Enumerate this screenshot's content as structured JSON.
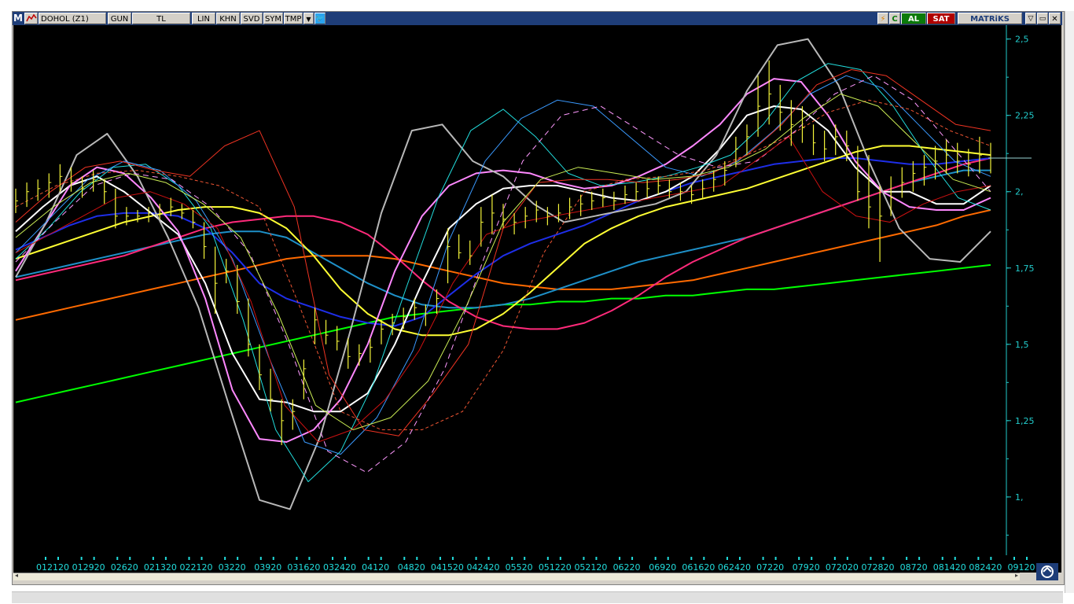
{
  "toolbar": {
    "logo": "M",
    "symbol": "DOHOL (Z1)",
    "period": "GUN",
    "currency": "TL",
    "buttons": [
      "LIN",
      "KHN",
      "SVD",
      "SYM",
      "TMP"
    ],
    "buy_label": "AL",
    "sell_label": "SAT",
    "brand": "MATRiKS",
    "colors": {
      "bar": "#1e3d78",
      "buy": "#0a7a0a",
      "sell": "#b00000",
      "brand": "#1e3d78"
    },
    "icons": [
      "app-logo-icon",
      "chart-type-icon",
      "dropdown-arrow-icon",
      "twitter-icon",
      "lightning-icon",
      "refresh-icon",
      "minimize-icon",
      "restore-icon",
      "close-icon"
    ]
  },
  "chart_data": {
    "type": "line",
    "symbol": "DOHOL (Z1)",
    "y_ticks": [
      "2,5",
      "2,25",
      "2,",
      "1,75",
      "1,5",
      "1,25",
      "1,"
    ],
    "y_tick_values": [
      2.5,
      2.25,
      2.0,
      1.75,
      1.5,
      1.25,
      1.0
    ],
    "ylim": [
      0.84,
      2.53
    ],
    "x_ticks": [
      "012120",
      "012920",
      "02620",
      "021320",
      "022120",
      "03220",
      "03920",
      "031620",
      "032420",
      "04120",
      "04820",
      "041520",
      "042420",
      "05520",
      "051220",
      "052120",
      "06220",
      "06920",
      "061620",
      "062420",
      "07220",
      "07920",
      "072020",
      "072820",
      "08720",
      "081420",
      "082420",
      "09120"
    ],
    "grid": false,
    "last_price": 2.11,
    "price_bars": [
      {
        "h": 2.01,
        "l": 1.93,
        "c": 1.97
      },
      {
        "h": 2.03,
        "l": 1.95,
        "c": 2.0
      },
      {
        "h": 2.04,
        "l": 1.97,
        "c": 2.01
      },
      {
        "h": 2.06,
        "l": 1.98,
        "c": 2.03
      },
      {
        "h": 2.09,
        "l": 2.0,
        "c": 2.05
      },
      {
        "h": 2.08,
        "l": 2.0,
        "c": 2.03
      },
      {
        "h": 2.05,
        "l": 1.98,
        "c": 2.01
      },
      {
        "h": 2.07,
        "l": 2.0,
        "c": 2.04
      },
      {
        "h": 2.04,
        "l": 1.96,
        "c": 2.0
      },
      {
        "h": 2.01,
        "l": 1.88,
        "c": 1.92
      },
      {
        "h": 1.95,
        "l": 1.89,
        "c": 1.92
      },
      {
        "h": 1.94,
        "l": 1.9,
        "c": 1.92
      },
      {
        "h": 1.95,
        "l": 1.9,
        "c": 1.93
      },
      {
        "h": 1.96,
        "l": 1.91,
        "c": 1.94
      },
      {
        "h": 1.98,
        "l": 1.92,
        "c": 1.95
      },
      {
        "h": 1.96,
        "l": 1.91,
        "c": 1.93
      },
      {
        "h": 1.94,
        "l": 1.88,
        "c": 1.9
      },
      {
        "h": 1.9,
        "l": 1.78,
        "c": 1.82
      },
      {
        "h": 1.82,
        "l": 1.6,
        "c": 1.7
      },
      {
        "h": 1.78,
        "l": 1.7,
        "c": 1.74
      },
      {
        "h": 1.76,
        "l": 1.6,
        "c": 1.64
      },
      {
        "h": 1.65,
        "l": 1.46,
        "c": 1.5
      },
      {
        "h": 1.5,
        "l": 1.35,
        "c": 1.4
      },
      {
        "h": 1.42,
        "l": 1.28,
        "c": 1.32
      },
      {
        "h": 1.32,
        "l": 1.17,
        "c": 1.25
      },
      {
        "h": 1.32,
        "l": 1.22,
        "c": 1.28
      },
      {
        "h": 1.45,
        "l": 1.32,
        "c": 1.42
      },
      {
        "h": 1.62,
        "l": 1.5,
        "c": 1.58
      },
      {
        "h": 1.58,
        "l": 1.5,
        "c": 1.53
      },
      {
        "h": 1.56,
        "l": 1.48,
        "c": 1.51
      },
      {
        "h": 1.52,
        "l": 1.42,
        "c": 1.46
      },
      {
        "h": 1.5,
        "l": 1.43,
        "c": 1.47
      },
      {
        "h": 1.52,
        "l": 1.44,
        "c": 1.49
      },
      {
        "h": 1.58,
        "l": 1.5,
        "c": 1.55
      },
      {
        "h": 1.6,
        "l": 1.53,
        "c": 1.57
      },
      {
        "h": 1.62,
        "l": 1.55,
        "c": 1.59
      },
      {
        "h": 1.65,
        "l": 1.58,
        "c": 1.62
      },
      {
        "h": 1.63,
        "l": 1.56,
        "c": 1.6
      },
      {
        "h": 1.68,
        "l": 1.6,
        "c": 1.65
      },
      {
        "h": 1.88,
        "l": 1.7,
        "c": 1.82
      },
      {
        "h": 1.86,
        "l": 1.78,
        "c": 1.8
      },
      {
        "h": 1.84,
        "l": 1.76,
        "c": 1.79
      },
      {
        "h": 1.95,
        "l": 1.82,
        "c": 1.9
      },
      {
        "h": 1.99,
        "l": 1.86,
        "c": 1.93
      },
      {
        "h": 1.96,
        "l": 1.88,
        "c": 1.91
      },
      {
        "h": 1.93,
        "l": 1.86,
        "c": 1.9
      },
      {
        "h": 1.95,
        "l": 1.88,
        "c": 1.92
      },
      {
        "h": 1.97,
        "l": 1.9,
        "c": 1.94
      },
      {
        "h": 1.95,
        "l": 1.89,
        "c": 1.92
      },
      {
        "h": 1.96,
        "l": 1.9,
        "c": 1.93
      },
      {
        "h": 1.98,
        "l": 1.91,
        "c": 1.95
      },
      {
        "h": 1.99,
        "l": 1.92,
        "c": 1.96
      },
      {
        "h": 2.0,
        "l": 1.94,
        "c": 1.97
      },
      {
        "h": 2.01,
        "l": 1.95,
        "c": 1.98
      },
      {
        "h": 2.0,
        "l": 1.94,
        "c": 1.97
      },
      {
        "h": 2.02,
        "l": 1.96,
        "c": 1.99
      },
      {
        "h": 2.03,
        "l": 1.97,
        "c": 2.0
      },
      {
        "h": 2.04,
        "l": 1.98,
        "c": 2.01
      },
      {
        "h": 2.05,
        "l": 1.99,
        "c": 2.02
      },
      {
        "h": 2.04,
        "l": 1.98,
        "c": 2.0
      },
      {
        "h": 2.03,
        "l": 1.97,
        "c": 2.0
      },
      {
        "h": 2.02,
        "l": 1.96,
        "c": 1.99
      },
      {
        "h": 2.04,
        "l": 1.98,
        "c": 2.01
      },
      {
        "h": 2.07,
        "l": 2.0,
        "c": 2.04
      },
      {
        "h": 2.1,
        "l": 2.02,
        "c": 2.07
      },
      {
        "h": 2.18,
        "l": 2.08,
        "c": 2.14
      },
      {
        "h": 2.22,
        "l": 2.12,
        "c": 2.18
      },
      {
        "h": 2.38,
        "l": 2.18,
        "c": 2.28
      },
      {
        "h": 2.43,
        "l": 2.22,
        "c": 2.32
      },
      {
        "h": 2.35,
        "l": 2.2,
        "c": 2.26
      },
      {
        "h": 2.3,
        "l": 2.15,
        "c": 2.22
      },
      {
        "h": 2.28,
        "l": 2.16,
        "c": 2.21
      },
      {
        "h": 2.22,
        "l": 2.12,
        "c": 2.16
      },
      {
        "h": 2.2,
        "l": 2.1,
        "c": 2.14
      },
      {
        "h": 2.22,
        "l": 2.12,
        "c": 2.18
      },
      {
        "h": 2.2,
        "l": 2.1,
        "c": 2.15
      },
      {
        "h": 2.15,
        "l": 1.97,
        "c": 2.0
      },
      {
        "h": 2.12,
        "l": 1.88,
        "c": 1.95
      },
      {
        "h": 2.02,
        "l": 1.77,
        "c": 1.92
      },
      {
        "h": 2.05,
        "l": 1.92,
        "c": 1.98
      },
      {
        "h": 2.08,
        "l": 1.98,
        "c": 2.03
      },
      {
        "h": 2.1,
        "l": 2.0,
        "c": 2.06
      },
      {
        "h": 2.12,
        "l": 2.02,
        "c": 2.08
      },
      {
        "h": 2.15,
        "l": 2.04,
        "c": 2.1
      },
      {
        "h": 2.17,
        "l": 2.06,
        "c": 2.12
      },
      {
        "h": 2.16,
        "l": 2.06,
        "c": 2.1
      },
      {
        "h": 2.14,
        "l": 2.05,
        "c": 2.09
      },
      {
        "h": 2.18,
        "l": 2.06,
        "c": 2.12
      },
      {
        "h": 2.16,
        "l": 2.06,
        "c": 2.11
      }
    ],
    "series": [
      {
        "color": "#00ff00",
        "width": 2,
        "dash": "",
        "values": [
          1.31,
          1.33,
          1.35,
          1.37,
          1.39,
          1.41,
          1.43,
          1.45,
          1.47,
          1.49,
          1.51,
          1.53,
          1.55,
          1.57,
          1.59,
          1.6,
          1.61,
          1.62,
          1.63,
          1.63,
          1.64,
          1.64,
          1.65,
          1.65,
          1.66,
          1.66,
          1.67,
          1.68,
          1.68,
          1.69,
          1.7,
          1.71,
          1.72,
          1.73,
          1.74,
          1.75,
          1.76
        ]
      },
      {
        "color": "#ff6a00",
        "width": 2,
        "dash": "",
        "values": [
          1.58,
          1.6,
          1.62,
          1.64,
          1.66,
          1.68,
          1.7,
          1.72,
          1.74,
          1.76,
          1.78,
          1.79,
          1.79,
          1.79,
          1.78,
          1.76,
          1.74,
          1.72,
          1.7,
          1.69,
          1.68,
          1.68,
          1.68,
          1.69,
          1.7,
          1.71,
          1.73,
          1.75,
          1.77,
          1.79,
          1.81,
          1.83,
          1.85,
          1.87,
          1.89,
          1.92,
          1.94
        ]
      },
      {
        "color": "#1e90c8",
        "width": 2,
        "dash": "",
        "values": [
          1.72,
          1.74,
          1.76,
          1.78,
          1.8,
          1.82,
          1.84,
          1.86,
          1.87,
          1.87,
          1.85,
          1.8,
          1.75,
          1.7,
          1.66,
          1.63,
          1.62,
          1.62,
          1.63,
          1.65,
          1.68,
          1.71,
          1.74,
          1.77,
          1.79,
          1.81,
          1.83,
          1.85,
          1.88,
          1.91,
          1.94,
          1.97,
          2.0,
          2.03,
          2.05,
          2.07,
          2.07
        ]
      },
      {
        "color": "#ff2a7a",
        "width": 2,
        "dash": "",
        "values": [
          1.71,
          1.73,
          1.75,
          1.77,
          1.79,
          1.82,
          1.85,
          1.88,
          1.9,
          1.91,
          1.92,
          1.92,
          1.9,
          1.86,
          1.79,
          1.71,
          1.64,
          1.59,
          1.56,
          1.55,
          1.55,
          1.57,
          1.61,
          1.66,
          1.72,
          1.77,
          1.81,
          1.85,
          1.88,
          1.91,
          1.94,
          1.97,
          2.0,
          2.03,
          2.06,
          2.09,
          2.11
        ]
      },
      {
        "color": "#1e2ee8",
        "width": 2,
        "dash": "",
        "values": [
          1.81,
          1.85,
          1.89,
          1.92,
          1.93,
          1.93,
          1.92,
          1.88,
          1.8,
          1.7,
          1.65,
          1.62,
          1.59,
          1.57,
          1.56,
          1.59,
          1.66,
          1.73,
          1.79,
          1.83,
          1.86,
          1.89,
          1.93,
          1.97,
          2.0,
          2.03,
          2.05,
          2.07,
          2.09,
          2.1,
          2.11,
          2.11,
          2.1,
          2.09,
          2.09,
          2.1,
          2.11
        ]
      },
      {
        "color": "#ffff33",
        "width": 2,
        "dash": "",
        "values": [
          1.78,
          1.81,
          1.84,
          1.87,
          1.9,
          1.92,
          1.94,
          1.95,
          1.95,
          1.93,
          1.88,
          1.79,
          1.68,
          1.6,
          1.55,
          1.53,
          1.53,
          1.55,
          1.6,
          1.67,
          1.75,
          1.83,
          1.88,
          1.92,
          1.95,
          1.97,
          1.99,
          2.01,
          2.04,
          2.07,
          2.1,
          2.13,
          2.15,
          2.15,
          2.14,
          2.13,
          2.12
        ]
      },
      {
        "color": "#ffffff",
        "width": 2,
        "dash": "",
        "values": [
          1.87,
          1.95,
          2.02,
          2.05,
          2.0,
          1.93,
          1.86,
          1.7,
          1.47,
          1.32,
          1.31,
          1.28,
          1.28,
          1.34,
          1.5,
          1.7,
          1.88,
          1.96,
          2.01,
          2.02,
          2.02,
          2.0,
          1.98,
          1.97,
          2.0,
          2.05,
          2.14,
          2.25,
          2.28,
          2.27,
          2.2,
          2.08,
          2.0,
          2.0,
          1.96,
          1.96,
          2.02
        ]
      },
      {
        "color": "#ff88ff",
        "width": 2,
        "dash": "",
        "values": [
          1.74,
          1.88,
          2.02,
          2.08,
          2.06,
          1.98,
          1.87,
          1.65,
          1.35,
          1.19,
          1.18,
          1.22,
          1.32,
          1.5,
          1.74,
          1.92,
          2.02,
          2.06,
          2.07,
          2.06,
          2.03,
          2.01,
          2.02,
          2.05,
          2.09,
          2.15,
          2.22,
          2.32,
          2.37,
          2.36,
          2.25,
          2.1,
          2.0,
          1.95,
          1.94,
          1.94,
          1.98
        ]
      },
      {
        "color": "#b8b8b8",
        "width": 2,
        "dash": "",
        "values": [
          1.72,
          1.9,
          2.12,
          2.19,
          2.05,
          1.85,
          1.62,
          1.3,
          0.99,
          0.96,
          1.2,
          1.55,
          1.93,
          2.2,
          2.22,
          2.1,
          2.05,
          1.96,
          1.9,
          1.92,
          1.94,
          1.96,
          2.0,
          2.12,
          2.33,
          2.48,
          2.5,
          2.35,
          2.1,
          1.88,
          1.78,
          1.77,
          1.87
        ]
      },
      {
        "color": "#22dddd",
        "width": 1,
        "dash": "",
        "values": [
          1.78,
          1.88,
          2.0,
          2.08,
          2.09,
          2.02,
          1.88,
          1.58,
          1.22,
          1.05,
          1.15,
          1.37,
          1.68,
          1.98,
          2.2,
          2.27,
          2.18,
          2.06,
          2.02,
          2.03,
          2.05,
          2.08,
          2.12,
          2.22,
          2.36,
          2.42,
          2.4,
          2.28,
          2.12,
          1.98,
          1.94
        ]
      },
      {
        "color": "#3a9aff",
        "width": 1,
        "dash": "",
        "values": [
          1.8,
          1.92,
          2.04,
          2.1,
          2.07,
          1.97,
          1.78,
          1.46,
          1.18,
          1.14,
          1.26,
          1.48,
          1.84,
          2.1,
          2.24,
          2.3,
          2.28,
          2.18,
          2.08,
          2.05,
          2.1,
          2.2,
          2.32,
          2.38,
          2.34,
          2.22,
          2.1,
          2.05
        ]
      },
      {
        "color": "#ee3322",
        "width": 1,
        "dash": "",
        "values": [
          1.9,
          2.0,
          2.08,
          2.1,
          2.07,
          2.05,
          2.15,
          2.2,
          1.95,
          1.4,
          1.22,
          1.2,
          1.34,
          1.5,
          1.88,
          2.03,
          2.04,
          2.04,
          2.03,
          2.04,
          2.06,
          2.12,
          2.22,
          2.35,
          2.4,
          2.38,
          2.3,
          2.22,
          2.2
        ]
      },
      {
        "color": "#ee5533",
        "width": 1,
        "dash": "4,3",
        "values": [
          1.95,
          2.02,
          2.06,
          2.07,
          2.05,
          2.02,
          1.95,
          1.62,
          1.28,
          1.22,
          1.22,
          1.28,
          1.48,
          1.8,
          2.0,
          2.04,
          2.05,
          2.07,
          2.12,
          2.18,
          2.26,
          2.3,
          2.27,
          2.2,
          2.15
        ]
      },
      {
        "color": "#ff99ff",
        "width": 1,
        "dash": "7,5",
        "values": [
          1.77,
          1.9,
          2.02,
          2.06,
          2.04,
          1.95,
          1.8,
          1.5,
          1.15,
          1.08,
          1.18,
          1.42,
          1.78,
          2.1,
          2.25,
          2.28,
          2.2,
          2.12,
          2.08,
          2.1,
          2.2,
          2.32,
          2.38,
          2.3,
          2.15,
          2.0
        ]
      },
      {
        "color": "#cc1111",
        "width": 1,
        "dash": "",
        "values": [
          1.8,
          1.86,
          1.92,
          1.98,
          2.0,
          1.96,
          1.88,
          1.64,
          1.3,
          1.18,
          1.22,
          1.32,
          1.48,
          1.7,
          1.86,
          1.9,
          1.92,
          1.94,
          1.96,
          1.98,
          2.0,
          2.02,
          2.1,
          2.18,
          2.0,
          1.92,
          1.9,
          1.96,
          2.0,
          2.02
        ]
      },
      {
        "color": "#ccee55",
        "width": 1,
        "dash": "",
        "values": [
          1.85,
          1.95,
          2.03,
          2.06,
          2.03,
          1.96,
          1.85,
          1.6,
          1.3,
          1.22,
          1.26,
          1.38,
          1.62,
          1.9,
          2.04,
          2.08,
          2.06,
          2.04,
          2.05,
          2.08,
          2.14,
          2.24,
          2.32,
          2.28,
          2.16,
          2.04,
          2.0
        ]
      }
    ]
  }
}
